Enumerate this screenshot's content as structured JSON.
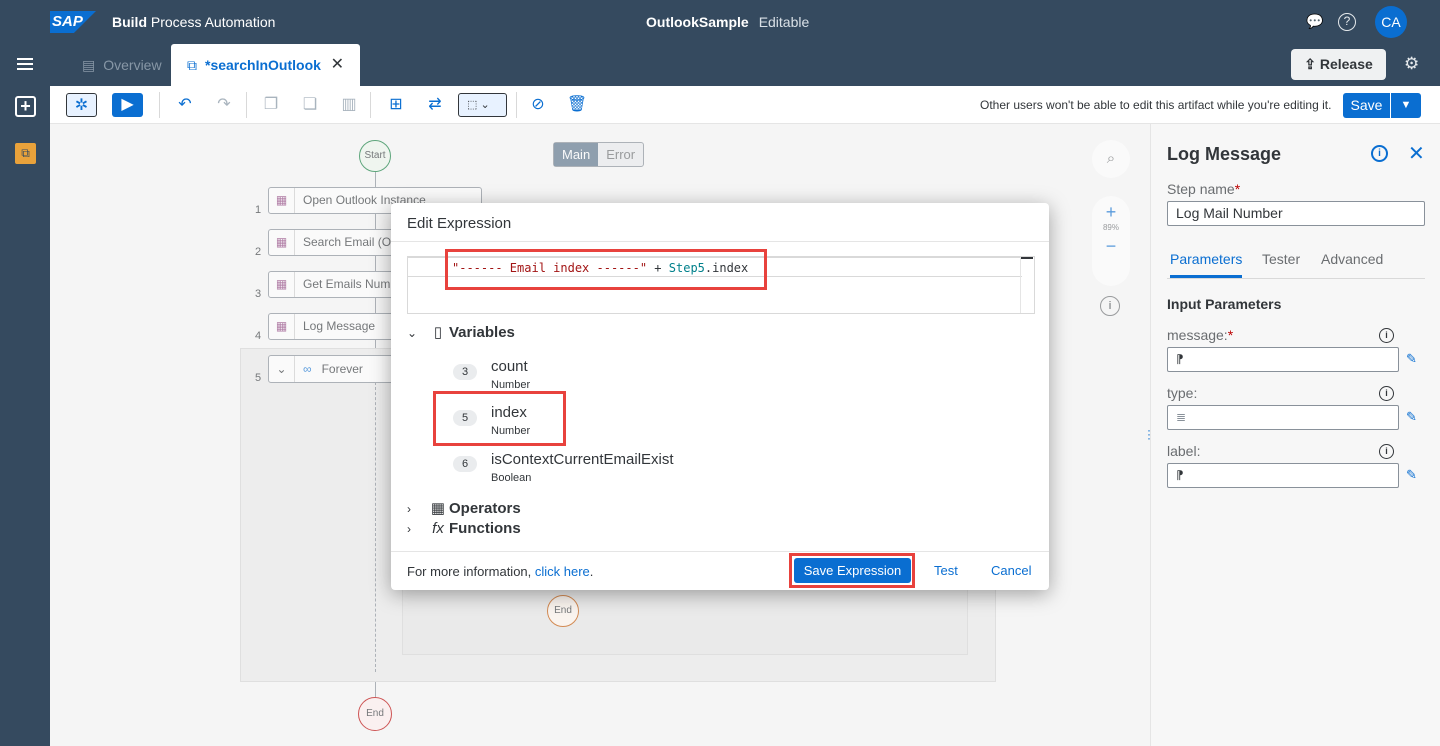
{
  "shell": {
    "logo": "SAP",
    "app_name_bold": "Build",
    "app_name_rest": " Process Automation",
    "project_name": "OutlookSample",
    "project_status": "Editable",
    "avatar_initials": "CA"
  },
  "tabs": {
    "overview": "Overview",
    "active": "*searchInOutlook",
    "close_glyph": "✕"
  },
  "release_label": "Release",
  "toolbar": {
    "lock_message": "Other users won't be able to edit this artifact while you're editing it.",
    "save_label": "Save"
  },
  "canvas": {
    "start_label": "Start",
    "end_label": "End",
    "inner_end_label": "End",
    "toggle_main": "Main",
    "toggle_error": "Error",
    "steps": [
      {
        "num": "1",
        "label": "Open Outlook Instance"
      },
      {
        "num": "2",
        "label": "Search Email (Ou"
      },
      {
        "num": "3",
        "label": "Get Emails Numb"
      },
      {
        "num": "4",
        "label": "Log Message"
      }
    ],
    "loop_num": "5",
    "loop_label": "Forever",
    "zoom_level": "89%"
  },
  "right_panel": {
    "title": "Log Message",
    "step_name_label": "Step name",
    "step_name_value": "Log Mail Number",
    "tabs": [
      "Parameters",
      "Tester",
      "Advanced"
    ],
    "section_title": "Input Parameters",
    "params": [
      {
        "label": "message:",
        "required": true
      },
      {
        "label": "type:",
        "required": false
      },
      {
        "label": "label:",
        "required": false
      }
    ]
  },
  "modal": {
    "title": "Edit Expression",
    "expression": {
      "string_part": "\"------ Email index ------\"",
      "operator": " + ",
      "ref": "Step5",
      "prop": ".index"
    },
    "sections": {
      "variables": "Variables",
      "operators": "Operators",
      "functions": "Functions"
    },
    "variables": [
      {
        "badge": "3",
        "name": "count",
        "type": "Number"
      },
      {
        "badge": "5",
        "name": "index",
        "type": "Number"
      },
      {
        "badge": "6",
        "name": "isContextCurrentEmailExist",
        "type": "Boolean"
      }
    ],
    "footer_text": "For more information, ",
    "footer_link": "click here",
    "footer_period": ".",
    "save_expression": "Save Expression",
    "test": "Test",
    "cancel": "Cancel"
  },
  "colors": {
    "shell_bg": "#354a5f",
    "accent": "#0a6ed1",
    "highlight": "#e8423d"
  }
}
